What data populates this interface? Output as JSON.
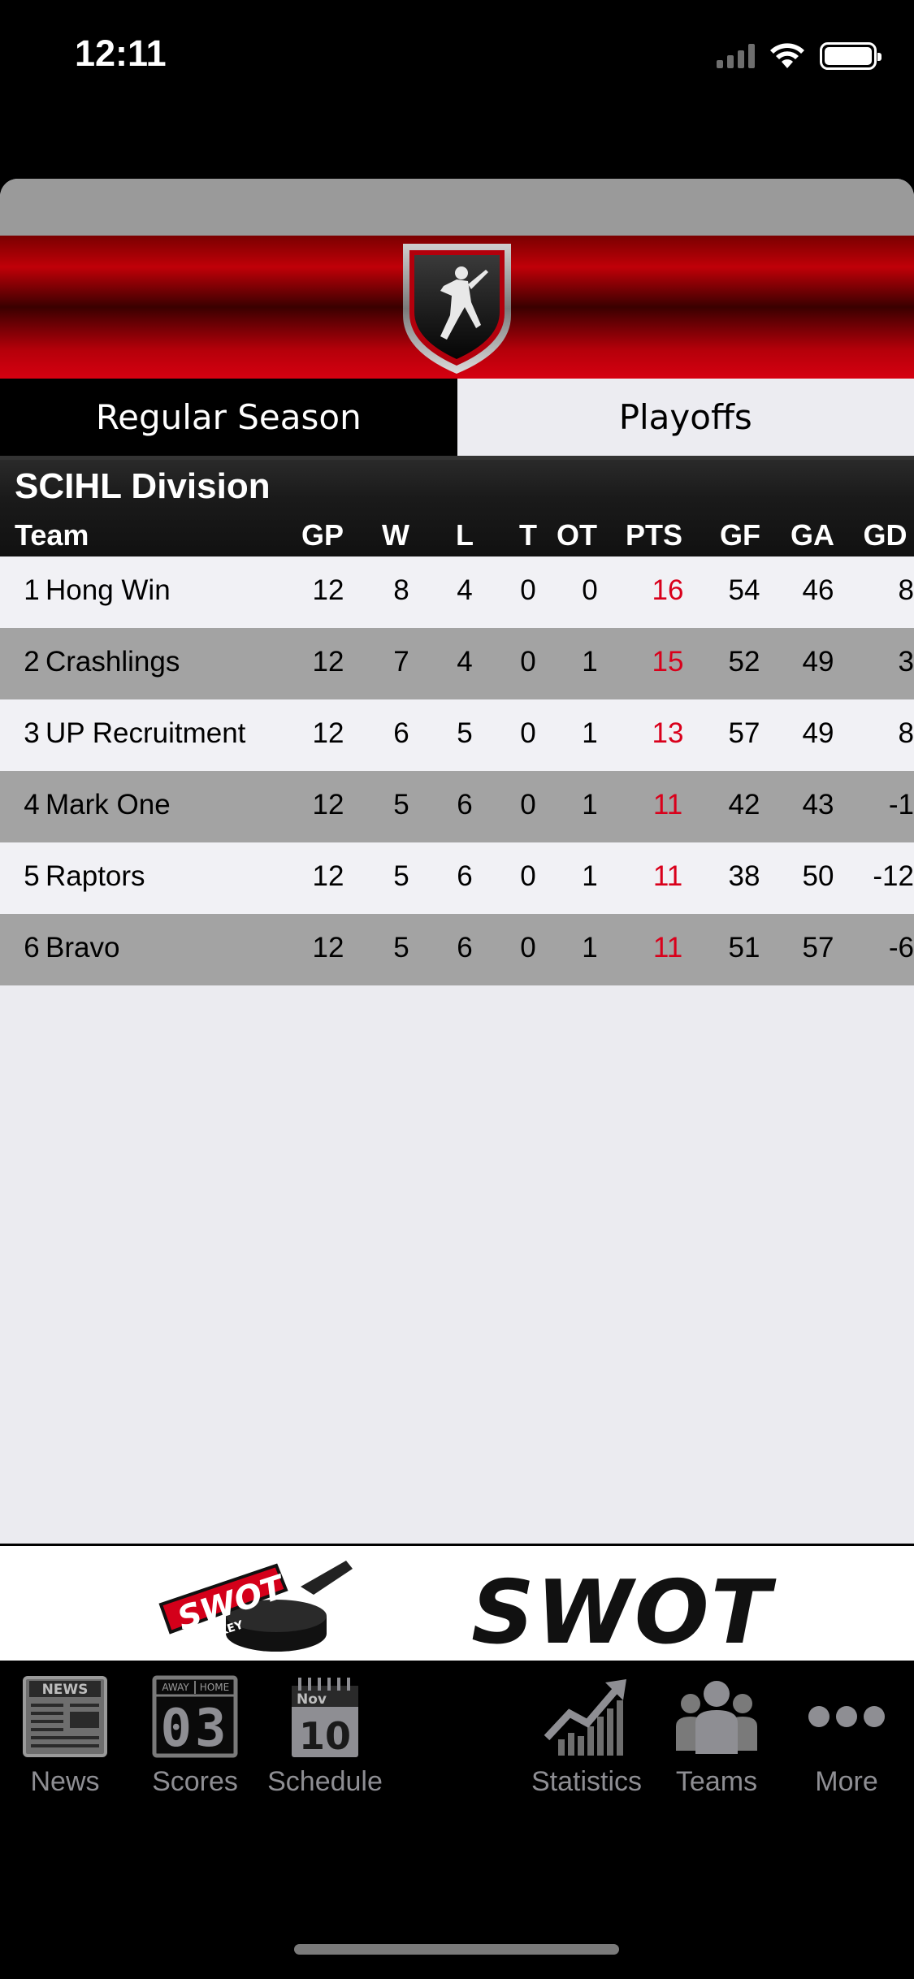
{
  "status": {
    "time": "12:11"
  },
  "tabs": {
    "regular": "Regular Season",
    "playoffs": "Playoffs"
  },
  "division": {
    "title": "SCIHL Division",
    "columns": [
      "Team",
      "GP",
      "W",
      "L",
      "T",
      "OT",
      "PTS",
      "GF",
      "GA",
      "GD"
    ]
  },
  "standings": [
    {
      "rank": "1",
      "team": "Hong Win",
      "gp": "12",
      "w": "8",
      "l": "4",
      "t": "0",
      "ot": "0",
      "pts": "16",
      "gf": "54",
      "ga": "46",
      "gd": "8"
    },
    {
      "rank": "2",
      "team": "Crashlings",
      "gp": "12",
      "w": "7",
      "l": "4",
      "t": "0",
      "ot": "1",
      "pts": "15",
      "gf": "52",
      "ga": "49",
      "gd": "3"
    },
    {
      "rank": "3",
      "team": "UP Recruitment",
      "gp": "12",
      "w": "6",
      "l": "5",
      "t": "0",
      "ot": "1",
      "pts": "13",
      "gf": "57",
      "ga": "49",
      "gd": "8"
    },
    {
      "rank": "4",
      "team": "Mark One",
      "gp": "12",
      "w": "5",
      "l": "6",
      "t": "0",
      "ot": "1",
      "pts": "11",
      "gf": "42",
      "ga": "43",
      "gd": "-1"
    },
    {
      "rank": "5",
      "team": "Raptors",
      "gp": "12",
      "w": "5",
      "l": "6",
      "t": "0",
      "ot": "1",
      "pts": "11",
      "gf": "38",
      "ga": "50",
      "gd": "-12"
    },
    {
      "rank": "6",
      "team": "Bravo",
      "gp": "12",
      "w": "5",
      "l": "6",
      "t": "0",
      "ot": "1",
      "pts": "11",
      "gf": "51",
      "ga": "57",
      "gd": "-6"
    }
  ],
  "ad": {
    "brand_text": "SWOT",
    "logo_text": "SWOT",
    "logo_subtext": "HOCKEY"
  },
  "tabbar": {
    "news": "News",
    "scores": "Scores",
    "schedule": "Schedule",
    "statistics": "Statistics",
    "teams": "Teams",
    "more": "More",
    "news_icon_text": "NEWS",
    "scores_icon_away": "AWAY",
    "scores_icon_home": "HOME",
    "scores_icon_digits": "03",
    "schedule_icon_month": "Nov",
    "schedule_icon_day": "10"
  },
  "colors": {
    "accent_red": "#d9001b",
    "banner_red": "#c00008",
    "tab_inactive": "#8e8e93"
  }
}
